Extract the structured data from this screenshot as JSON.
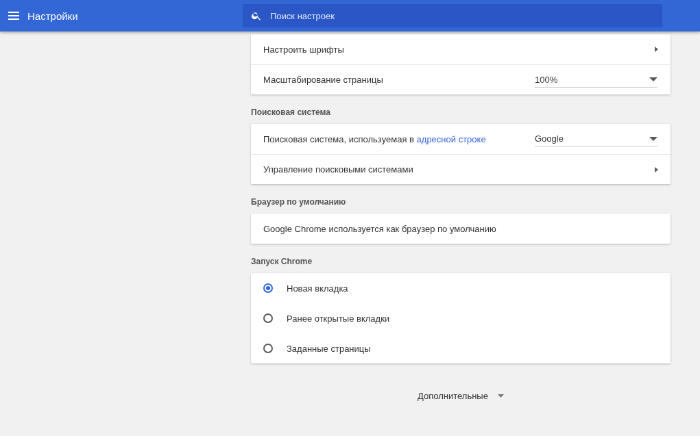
{
  "header": {
    "title": "Настройки",
    "search": {
      "placeholder": "Поиск настроек"
    }
  },
  "sections": [
    {
      "rows": [
        {
          "kind": "link",
          "label": "Настроить шрифты"
        },
        {
          "kind": "dropdown",
          "label": "Масштабирование страницы",
          "value": "100%"
        }
      ]
    },
    {
      "title": "Поисковая система",
      "rows": [
        {
          "kind": "dropdown",
          "label": "Поисковая система, используемая в ",
          "link": "адресной строке",
          "value": "Google"
        },
        {
          "kind": "link",
          "label": "Управление поисковыми системами"
        }
      ]
    },
    {
      "title": "Браузер по умолчанию",
      "rows": [
        {
          "kind": "text",
          "label": "Google Chrome используется как браузер по умолчанию"
        }
      ]
    },
    {
      "title": "Запуск Chrome",
      "rows": [
        {
          "kind": "radio",
          "label": "Новая вкладка",
          "selected": true
        },
        {
          "kind": "radio",
          "label": "Ранее открытые вкладки",
          "selected": false
        },
        {
          "kind": "radio",
          "label": "Заданные страницы",
          "selected": false
        }
      ]
    }
  ],
  "advanced": {
    "label": "Дополнительные"
  }
}
